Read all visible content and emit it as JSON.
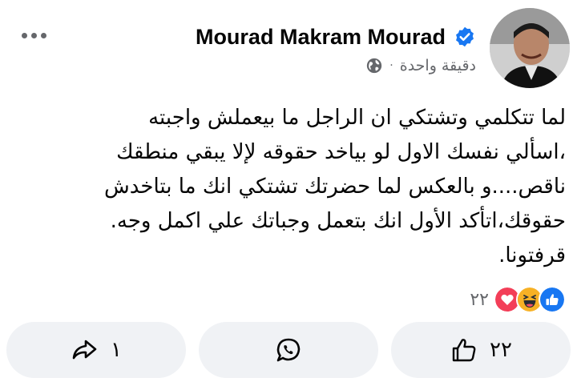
{
  "post": {
    "author": "Mourad Makram Mourad",
    "time": "دقيقة واحدة",
    "dot": "·",
    "body_lines": [
      "لما تتكلمي وتشتكي ان الراجل ما بيعملش واجبته",
      "،اسألي نفسك الاول لو بياخد حقوقه لإلا يبقي منطقك",
      "ناقص....و بالعكس لما حضرتك تشتكي انك ما بتاخدش",
      "حقوقك،اتأكد الأول انك بتعمل وجباتك علي اكمل وجه.",
      "قرفتونا."
    ]
  },
  "reactions": {
    "count": "٢٢",
    "icons": [
      "love-reaction-icon",
      "haha-reaction-icon",
      "like-reaction-icon"
    ]
  },
  "actions": {
    "share_count": "١",
    "like_count": "٢٢"
  },
  "colors": {
    "verified": "#1877f2",
    "love": "#f33e58",
    "haha": "#f7b125",
    "like": "#1877f2",
    "secondary_text": "#65676b",
    "button_bg": "#f0f2f5"
  }
}
